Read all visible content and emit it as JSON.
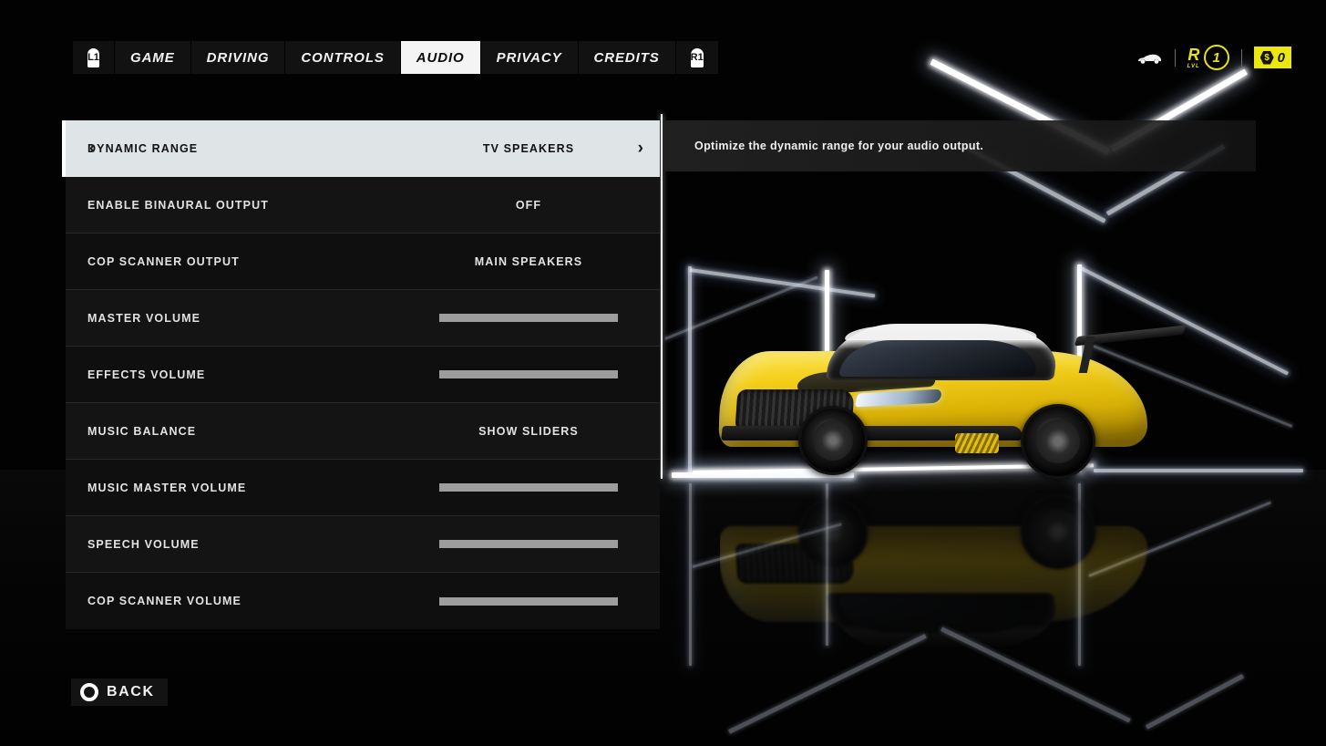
{
  "nav": {
    "left_bumper": "L1",
    "right_bumper": "R1",
    "tabs": [
      {
        "label": "GAME",
        "active": false
      },
      {
        "label": "DRIVING",
        "active": false
      },
      {
        "label": "CONTROLS",
        "active": false
      },
      {
        "label": "AUDIO",
        "active": true
      },
      {
        "label": "PRIVACY",
        "active": false
      },
      {
        "label": "CREDITS",
        "active": false
      }
    ]
  },
  "hud": {
    "car_icon": "car-icon",
    "rank_letter": "R",
    "rank_sublabel": "LVL",
    "level": "1",
    "currency_icon": "coin-icon",
    "currency_symbol": "$",
    "currency_amount": "0",
    "accent_color": "#ece70f"
  },
  "settings": {
    "rows": [
      {
        "label": "DYNAMIC RANGE",
        "type": "selector",
        "value": "TV SPEAKERS",
        "selected": true,
        "left_arrow": "‹",
        "right_arrow": "›"
      },
      {
        "label": "ENABLE BINAURAL OUTPUT",
        "type": "selector",
        "value": "OFF",
        "selected": false
      },
      {
        "label": "COP SCANNER OUTPUT",
        "type": "selector",
        "value": "MAIN SPEAKERS",
        "selected": false
      },
      {
        "label": "MASTER VOLUME",
        "type": "slider",
        "value": 100,
        "selected": false
      },
      {
        "label": "EFFECTS VOLUME",
        "type": "slider",
        "value": 100,
        "selected": false
      },
      {
        "label": "MUSIC BALANCE",
        "type": "selector",
        "value": "SHOW SLIDERS",
        "selected": false
      },
      {
        "label": "MUSIC MASTER VOLUME",
        "type": "slider",
        "value": 100,
        "selected": false
      },
      {
        "label": "SPEECH VOLUME",
        "type": "slider",
        "value": 100,
        "selected": false
      },
      {
        "label": "COP SCANNER VOLUME",
        "type": "slider",
        "value": 100,
        "selected": false
      }
    ]
  },
  "description": {
    "text": "Optimize the dynamic range for your audio output."
  },
  "footer": {
    "back_icon": "circle-button-icon",
    "back_label": "BACK"
  }
}
